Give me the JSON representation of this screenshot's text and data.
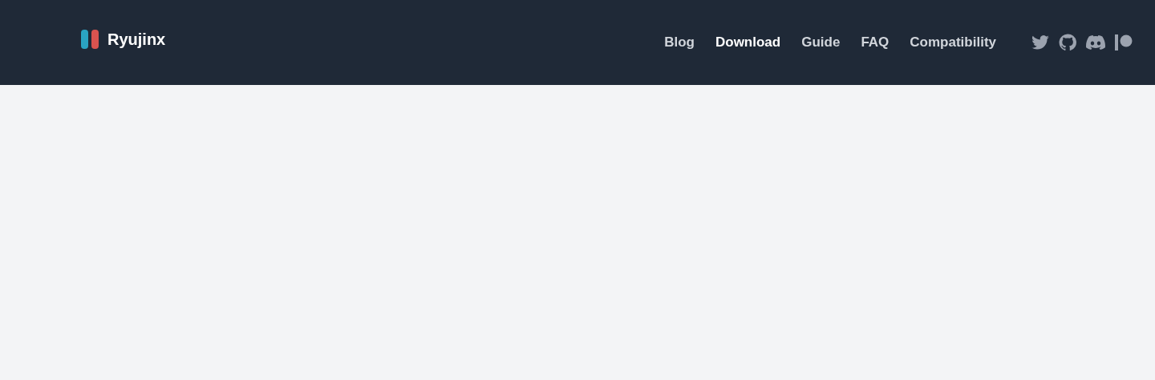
{
  "brand": {
    "name": "Ryujinx"
  },
  "nav": [
    {
      "label": "Blog",
      "selected": false
    },
    {
      "label": "Download",
      "selected": true
    },
    {
      "label": "Guide",
      "selected": false
    },
    {
      "label": "FAQ",
      "selected": false
    },
    {
      "label": "Compatibility",
      "selected": false
    }
  ],
  "social": [
    {
      "kind": "bird"
    },
    {
      "kind": "cat"
    },
    {
      "kind": "controller"
    },
    {
      "kind": "patron"
    }
  ]
}
